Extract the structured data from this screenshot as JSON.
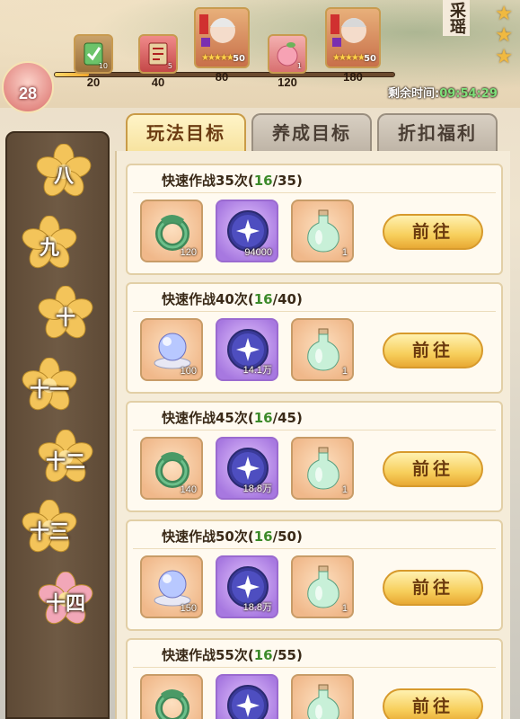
{
  "header": {
    "level": "28",
    "progress_fraction": 0.1,
    "milestones": [
      {
        "points": "20",
        "count": "10",
        "kind": "scroll"
      },
      {
        "points": "40",
        "count": "5",
        "kind": "talisman"
      },
      {
        "points": "80",
        "count": "50",
        "kind": "hero"
      },
      {
        "points": "120",
        "count": "1",
        "kind": "peach"
      },
      {
        "points": "180",
        "count": "50",
        "kind": "hero"
      }
    ],
    "timer_label": "剩余时间:",
    "timer_value": "09:54:29",
    "char_name": "采瑶"
  },
  "sidebar": {
    "chapters": [
      {
        "label": "八",
        "color": "#f3c45a"
      },
      {
        "label": "九",
        "color": "#f3c45a"
      },
      {
        "label": "十",
        "color": "#f3c45a"
      },
      {
        "label": "十一",
        "color": "#f3c45a"
      },
      {
        "label": "十二",
        "color": "#f3c45a"
      },
      {
        "label": "十三",
        "color": "#f3c45a"
      },
      {
        "label": "十四",
        "color": "#f2a7b8"
      }
    ]
  },
  "tabs": [
    {
      "label": "玩法目标",
      "active": true
    },
    {
      "label": "养成目标",
      "active": false
    },
    {
      "label": "折扣福利",
      "active": false
    }
  ],
  "tasks": [
    {
      "title": "快速作战35次",
      "progress": "16",
      "target": "35",
      "rewards": [
        {
          "icon": "jade-dragon-icon",
          "count": "120",
          "bg": "orange"
        },
        {
          "icon": "star-orb-icon",
          "count": "94000",
          "bg": "purple"
        },
        {
          "icon": "potion-bottle-icon",
          "count": "1",
          "bg": "orange"
        }
      ],
      "button": "前往"
    },
    {
      "title": "快速作战40次",
      "progress": "16",
      "target": "40",
      "rewards": [
        {
          "icon": "crystal-ball-icon",
          "count": "100",
          "bg": "orange"
        },
        {
          "icon": "star-orb-icon",
          "count": "14.1万",
          "bg": "purple"
        },
        {
          "icon": "potion-bottle-icon",
          "count": "1",
          "bg": "orange"
        }
      ],
      "button": "前往"
    },
    {
      "title": "快速作战45次",
      "progress": "16",
      "target": "45",
      "rewards": [
        {
          "icon": "jade-dragon-icon",
          "count": "140",
          "bg": "orange"
        },
        {
          "icon": "star-orb-icon",
          "count": "18.8万",
          "bg": "purple"
        },
        {
          "icon": "potion-bottle-icon",
          "count": "1",
          "bg": "orange"
        }
      ],
      "button": "前往"
    },
    {
      "title": "快速作战50次",
      "progress": "16",
      "target": "50",
      "rewards": [
        {
          "icon": "crystal-ball-icon",
          "count": "150",
          "bg": "orange"
        },
        {
          "icon": "star-orb-icon",
          "count": "18.8万",
          "bg": "purple"
        },
        {
          "icon": "potion-bottle-icon",
          "count": "1",
          "bg": "orange"
        }
      ],
      "button": "前往"
    },
    {
      "title": "快速作战55次",
      "progress": "16",
      "target": "55",
      "rewards": [
        {
          "icon": "jade-dragon-icon",
          "count": "",
          "bg": "orange"
        },
        {
          "icon": "star-orb-icon",
          "count": "",
          "bg": "purple"
        },
        {
          "icon": "potion-bottle-icon",
          "count": "",
          "bg": "orange"
        }
      ],
      "button": "前往"
    }
  ]
}
